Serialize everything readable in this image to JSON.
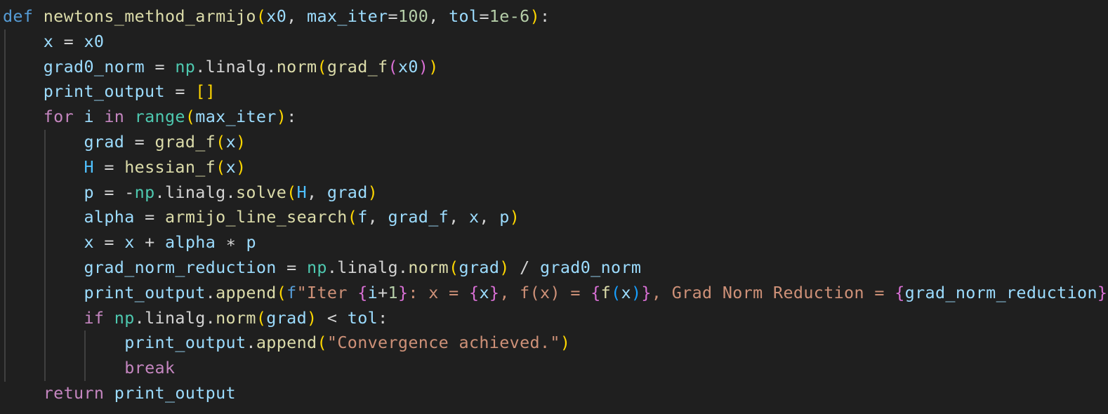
{
  "editor": {
    "background": "#1f1f1f",
    "language": "python",
    "lines": [
      [
        [
          "def",
          "kw"
        ],
        [
          " ",
          "op"
        ],
        [
          "newtons_method_armijo",
          "fn"
        ],
        [
          "(",
          "p1"
        ],
        [
          "x0",
          "var"
        ],
        [
          ", ",
          "op"
        ],
        [
          "max_iter",
          "var"
        ],
        [
          "=",
          "op"
        ],
        [
          "100",
          "num"
        ],
        [
          ", ",
          "op"
        ],
        [
          "tol",
          "var"
        ],
        [
          "=",
          "op"
        ],
        [
          "1e-6",
          "num"
        ],
        [
          ")",
          "p1"
        ],
        [
          ":",
          "op"
        ]
      ],
      [
        [
          "    ",
          "op"
        ],
        [
          "x",
          "var"
        ],
        [
          " = ",
          "op"
        ],
        [
          "x0",
          "var"
        ]
      ],
      [
        [
          "    ",
          "op"
        ],
        [
          "grad0_norm",
          "var"
        ],
        [
          " = ",
          "op"
        ],
        [
          "np",
          "mod"
        ],
        [
          ".linalg.",
          "op"
        ],
        [
          "norm",
          "fn"
        ],
        [
          "(",
          "p1"
        ],
        [
          "grad_f",
          "fn"
        ],
        [
          "(",
          "p2"
        ],
        [
          "x0",
          "var"
        ],
        [
          ")",
          "p2"
        ],
        [
          ")",
          "p1"
        ]
      ],
      [
        [
          "    ",
          "op"
        ],
        [
          "print_output",
          "var"
        ],
        [
          " = ",
          "op"
        ],
        [
          "[]",
          "p1"
        ]
      ],
      [
        [
          "    ",
          "op"
        ],
        [
          "for",
          "ctrl"
        ],
        [
          " ",
          "op"
        ],
        [
          "i",
          "var"
        ],
        [
          " ",
          "op"
        ],
        [
          "in",
          "ctrl"
        ],
        [
          " ",
          "op"
        ],
        [
          "range",
          "mod"
        ],
        [
          "(",
          "p1"
        ],
        [
          "max_iter",
          "var"
        ],
        [
          ")",
          "p1"
        ],
        [
          ":",
          "op"
        ]
      ],
      [
        [
          "        ",
          "op"
        ],
        [
          "grad",
          "var"
        ],
        [
          " = ",
          "op"
        ],
        [
          "grad_f",
          "fn"
        ],
        [
          "(",
          "p1"
        ],
        [
          "x",
          "var"
        ],
        [
          ")",
          "p1"
        ]
      ],
      [
        [
          "        ",
          "op"
        ],
        [
          "H",
          "const"
        ],
        [
          " = ",
          "op"
        ],
        [
          "hessian_f",
          "fn"
        ],
        [
          "(",
          "p1"
        ],
        [
          "x",
          "var"
        ],
        [
          ")",
          "p1"
        ]
      ],
      [
        [
          "        ",
          "op"
        ],
        [
          "p",
          "var"
        ],
        [
          " = -",
          "op"
        ],
        [
          "np",
          "mod"
        ],
        [
          ".linalg.",
          "op"
        ],
        [
          "solve",
          "fn"
        ],
        [
          "(",
          "p1"
        ],
        [
          "H",
          "const"
        ],
        [
          ", ",
          "op"
        ],
        [
          "grad",
          "var"
        ],
        [
          ")",
          "p1"
        ]
      ],
      [
        [
          "        ",
          "op"
        ],
        [
          "alpha",
          "var"
        ],
        [
          " = ",
          "op"
        ],
        [
          "armijo_line_search",
          "fn"
        ],
        [
          "(",
          "p1"
        ],
        [
          "f",
          "var"
        ],
        [
          ", ",
          "op"
        ],
        [
          "grad_f",
          "var"
        ],
        [
          ", ",
          "op"
        ],
        [
          "x",
          "var"
        ],
        [
          ", ",
          "op"
        ],
        [
          "p",
          "var"
        ],
        [
          ")",
          "p1"
        ]
      ],
      [
        [
          "        ",
          "op"
        ],
        [
          "x",
          "var"
        ],
        [
          " = ",
          "op"
        ],
        [
          "x",
          "var"
        ],
        [
          " + ",
          "op"
        ],
        [
          "alpha",
          "var"
        ],
        [
          " ∗ ",
          "op"
        ],
        [
          "p",
          "var"
        ]
      ],
      [
        [
          "        ",
          "op"
        ],
        [
          "grad_norm_reduction",
          "var"
        ],
        [
          " = ",
          "op"
        ],
        [
          "np",
          "mod"
        ],
        [
          ".linalg.",
          "op"
        ],
        [
          "norm",
          "fn"
        ],
        [
          "(",
          "p1"
        ],
        [
          "grad",
          "var"
        ],
        [
          ")",
          "p1"
        ],
        [
          " / ",
          "op"
        ],
        [
          "grad0_norm",
          "var"
        ]
      ],
      [
        [
          "        ",
          "op"
        ],
        [
          "print_output",
          "var"
        ],
        [
          ".",
          "op"
        ],
        [
          "append",
          "fn"
        ],
        [
          "(",
          "p1"
        ],
        [
          "f",
          "kw"
        ],
        [
          "\"Iter ",
          "str"
        ],
        [
          "{",
          "p2"
        ],
        [
          "i",
          "var"
        ],
        [
          "+",
          "op"
        ],
        [
          "1",
          "num"
        ],
        [
          "}",
          "p2"
        ],
        [
          ": x = ",
          "str"
        ],
        [
          "{",
          "p2"
        ],
        [
          "x",
          "var"
        ],
        [
          "}",
          "p2"
        ],
        [
          ", f(x) = ",
          "str"
        ],
        [
          "{",
          "p2"
        ],
        [
          "f",
          "fn"
        ],
        [
          "(",
          "p3"
        ],
        [
          "x",
          "var"
        ],
        [
          ")",
          "p3"
        ],
        [
          "}",
          "p2"
        ],
        [
          ", Grad Norm Reduction = ",
          "str"
        ],
        [
          "{",
          "p2"
        ],
        [
          "grad_norm_reduction",
          "var"
        ],
        [
          "}",
          "p2"
        ]
      ],
      [
        [
          "        ",
          "op"
        ],
        [
          "if",
          "ctrl"
        ],
        [
          " ",
          "op"
        ],
        [
          "np",
          "mod"
        ],
        [
          ".linalg.",
          "op"
        ],
        [
          "norm",
          "fn"
        ],
        [
          "(",
          "p1"
        ],
        [
          "grad",
          "var"
        ],
        [
          ")",
          "p1"
        ],
        [
          " < ",
          "op"
        ],
        [
          "tol",
          "var"
        ],
        [
          ":",
          "op"
        ]
      ],
      [
        [
          "            ",
          "op"
        ],
        [
          "print_output",
          "var"
        ],
        [
          ".",
          "op"
        ],
        [
          "append",
          "fn"
        ],
        [
          "(",
          "p1"
        ],
        [
          "\"Convergence achieved.\"",
          "str"
        ],
        [
          ")",
          "p1"
        ]
      ],
      [
        [
          "            ",
          "op"
        ],
        [
          "break",
          "ctrl"
        ]
      ],
      [
        [
          "    ",
          "op"
        ],
        [
          "return",
          "ctrl"
        ],
        [
          " ",
          "op"
        ],
        [
          "print_output",
          "var"
        ]
      ]
    ]
  }
}
